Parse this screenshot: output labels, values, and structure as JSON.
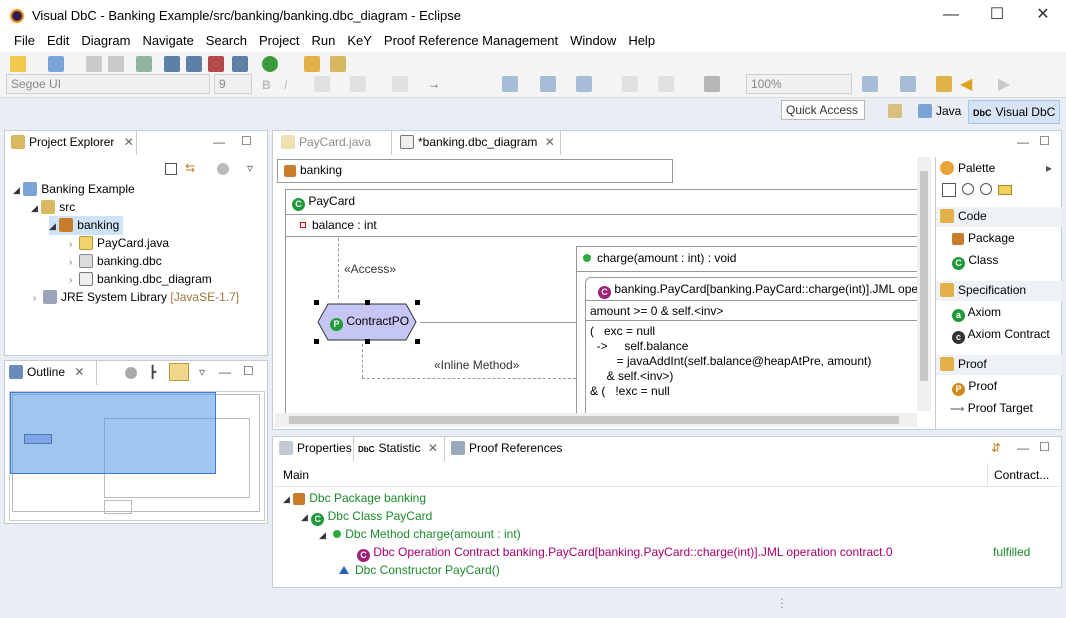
{
  "window": {
    "title": "Visual DbC - Banking Example/src/banking/banking.dbc_diagram - Eclipse"
  },
  "menu": [
    "File",
    "Edit",
    "Diagram",
    "Navigate",
    "Search",
    "Project",
    "Run",
    "KeY",
    "Proof Reference Management",
    "Window",
    "Help"
  ],
  "toolbar": {
    "font_name": "Segoe UI",
    "font_size": "9",
    "zoom": "100%"
  },
  "quick_access": {
    "placeholder": "Quick Access"
  },
  "perspectives": {
    "java": "Java",
    "visual_dbc": "Visual DbC"
  },
  "project_explorer": {
    "title": "Project Explorer",
    "items": [
      "Banking Example",
      "src",
      "banking",
      "PayCard.java",
      "banking.dbc",
      "banking.dbc_diagram",
      "JRE System Library"
    ],
    "jre_suffix": "[JavaSE-1.7]"
  },
  "outline": {
    "title": "Outline"
  },
  "editor": {
    "tabs": [
      "PayCard.java",
      "*banking.dbc_diagram"
    ],
    "package_label": "banking",
    "class_label": "PayCard",
    "attribute": "balance : int",
    "access_label": "«Access»",
    "inline_label": "«Inline Method»",
    "contract_po": "ContractPO",
    "method_label": "charge(amount : int) : void",
    "contract_title": "banking.PayCard[banking.PayCard::charge(int)].JML ope",
    "precondition": "amount >= 0 & self.<inv>",
    "post_lines": [
      "(   exc = null",
      "  ->     self.balance",
      "        = javaAddInt(self.balance@heapAtPre, amount)",
      "     & self.<inv>)",
      "& (   !exc = null"
    ]
  },
  "palette": {
    "title": "Palette",
    "groups": [
      {
        "name": "Code",
        "items": [
          "Package",
          "Class"
        ]
      },
      {
        "name": "Specification",
        "items": [
          "Axiom",
          "Axiom Contract"
        ]
      },
      {
        "name": "Proof",
        "items": [
          "Proof",
          "Proof Target"
        ]
      }
    ]
  },
  "bottom": {
    "tabs": [
      "Properties",
      "Statistic",
      "Proof References"
    ],
    "col_main": "Main",
    "col_contract": "Contract...",
    "rows": [
      "Dbc Package banking",
      "Dbc Class PayCard",
      "Dbc Method charge(amount : int)",
      "Dbc Operation Contract banking.PayCard[banking.PayCard::charge(int)].JML operation contract.0",
      "Dbc Constructor PayCard()"
    ],
    "status": "fulfilled"
  },
  "colors": {
    "green": "#1b8a2a",
    "purple": "#a8006e",
    "selection": "#cfe3f7"
  }
}
